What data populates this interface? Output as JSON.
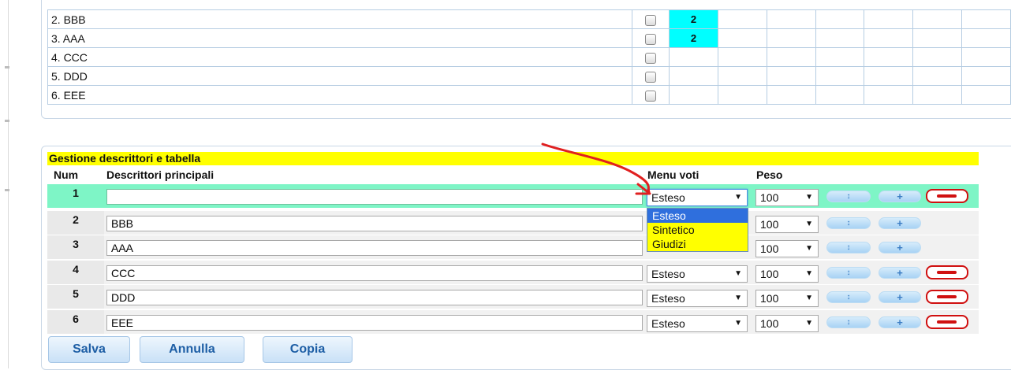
{
  "student_table": {
    "rows": [
      {
        "name": "2. BBB",
        "score": "2"
      },
      {
        "name": "3. AAA",
        "score": "2"
      },
      {
        "name": "4. CCC",
        "score": ""
      },
      {
        "name": "5. DDD",
        "score": ""
      },
      {
        "name": "6. EEE",
        "score": ""
      }
    ],
    "score_highlight_color": "#00ffff"
  },
  "descriptors": {
    "title": "Gestione descrittori e tabella",
    "title_color": "#ffff00",
    "headers": {
      "num": "Num",
      "desc": "Descrittori principali",
      "voti": "Menu voti",
      "peso": "Peso"
    },
    "rows": [
      {
        "num": "1",
        "desc": "",
        "voti": "Esteso",
        "peso": "100",
        "active": true
      },
      {
        "num": "2",
        "desc": "BBB",
        "voti": "",
        "peso": "100"
      },
      {
        "num": "3",
        "desc": "AAA",
        "voti": "",
        "peso": "100"
      },
      {
        "num": "4",
        "desc": "CCC",
        "voti": "Esteso",
        "peso": "100"
      },
      {
        "num": "5",
        "desc": "DDD",
        "voti": "Esteso",
        "peso": "100"
      },
      {
        "num": "6",
        "desc": "EEE",
        "voti": "Esteso",
        "peso": "100"
      }
    ],
    "dropdown_options": [
      "Esteso",
      "Sintetico",
      "Giudizi"
    ],
    "active_row_color": "#7ef5c6"
  },
  "icons": {
    "move": "up-down-arrow-icon",
    "add": "plus-icon",
    "remove": "minus-icon"
  },
  "buttons": {
    "save": "Salva",
    "cancel": "Annulla",
    "copy": "Copia"
  },
  "annotation_color": "#e02020"
}
